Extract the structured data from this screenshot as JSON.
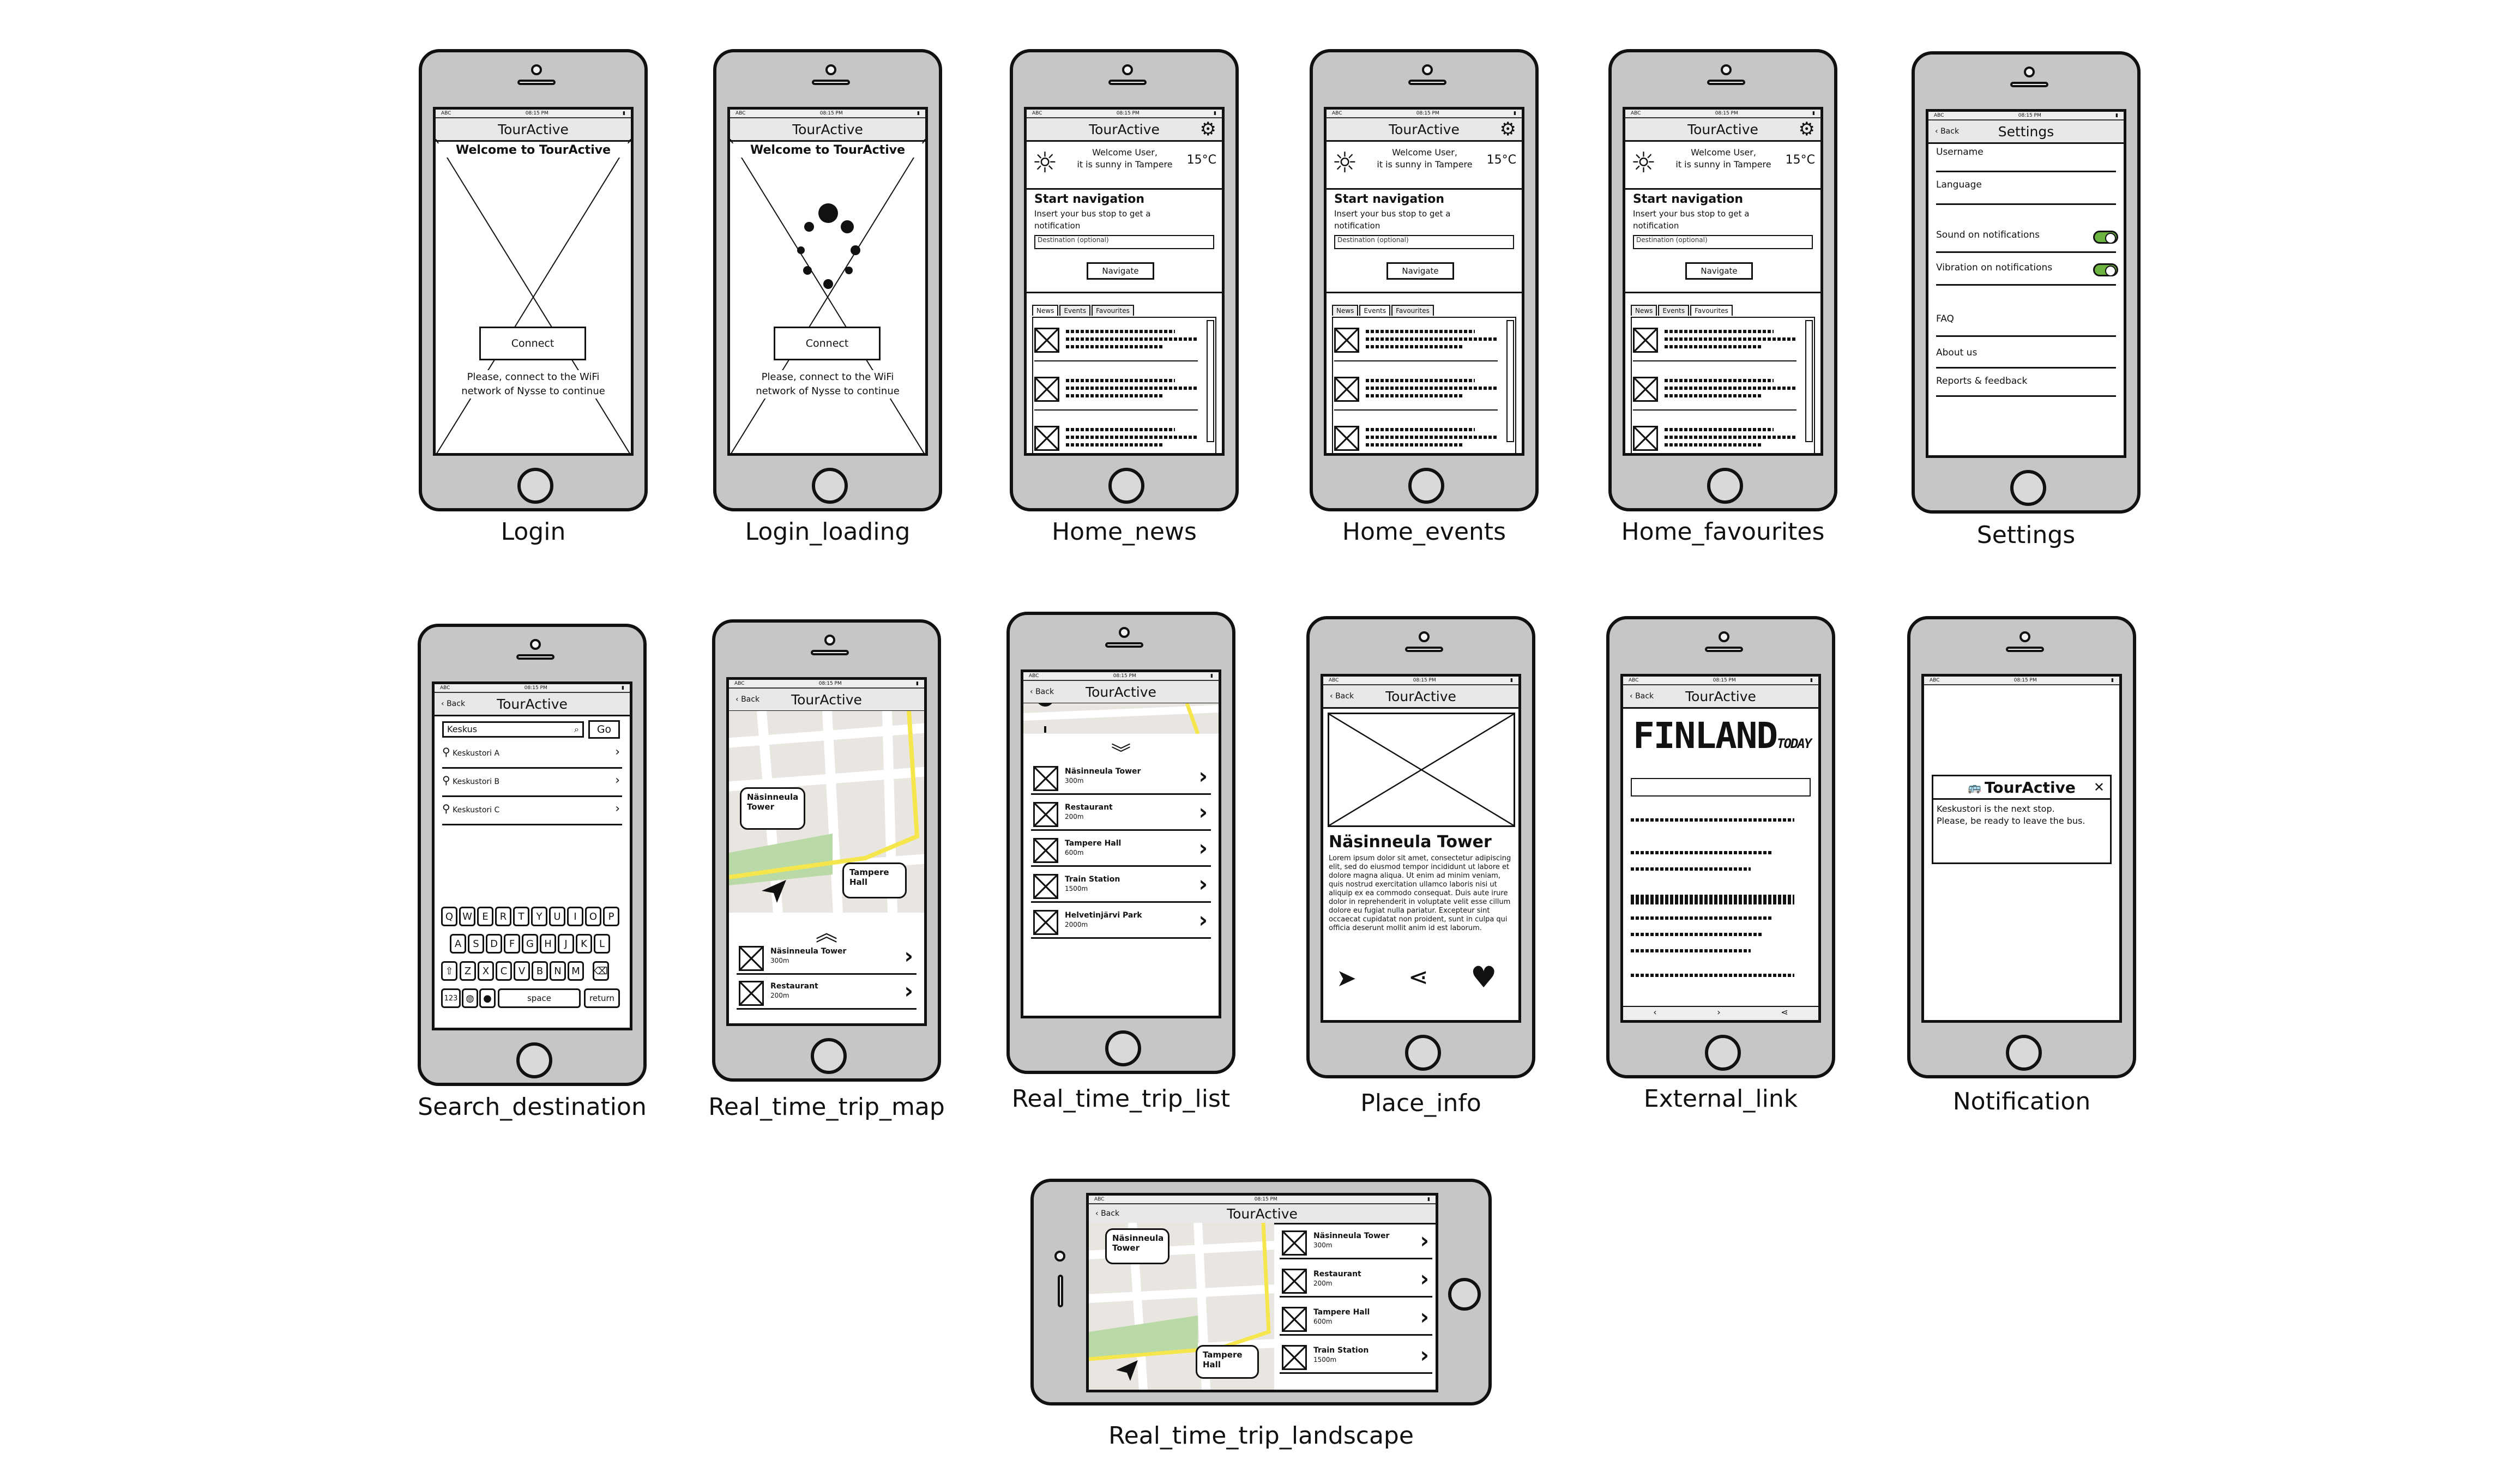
{
  "app": {
    "name": "TourActive",
    "status_left": "ABC",
    "status_time": "08:15 PM"
  },
  "captions": {
    "login": "Login",
    "login_loading": "Login_loading",
    "home_news": "Home_news",
    "home_events": "Home_events",
    "home_favourites": "Home_favourites",
    "settings": "Settings",
    "search": "Search_destination",
    "rt_map": "Real_time_trip_map",
    "rt_list": "Real_time_trip_list",
    "place": "Place_info",
    "external": "External_link",
    "notification": "Notification",
    "landscape": "Real_time_trip_landscape"
  },
  "login": {
    "welcome": "Welcome to TourActive",
    "connect": "Connect",
    "note": "Please, connect to the WiFi network of Nysse to continue"
  },
  "home": {
    "greeting_1": "Welcome User,",
    "greeting_2": "it is sunny in Tampere",
    "temp": "15°C",
    "nav_title": "Start navigation",
    "nav_desc": "Insert your bus stop to get a notification",
    "dest_placeholder": "Destination (optional)",
    "navigate": "Navigate",
    "tabs": [
      "News",
      "Events",
      "Favourites"
    ]
  },
  "settings": {
    "back": "Back",
    "title": "Settings",
    "username": "Username",
    "language": "Language",
    "sound": "Sound on notifications",
    "vibration": "Vibration on notifications",
    "faq": "FAQ",
    "about": "About us",
    "reports": "Reports & feedback"
  },
  "search": {
    "back": "Back",
    "query": "Keskus",
    "go": "Go",
    "results": [
      "Keskustori A",
      "Keskustori B",
      "Keskustori C"
    ],
    "keys_row1": [
      "Q",
      "W",
      "E",
      "R",
      "T",
      "Y",
      "U",
      "I",
      "O",
      "P"
    ],
    "keys_row2": [
      "A",
      "S",
      "D",
      "F",
      "G",
      "H",
      "J",
      "K",
      "L"
    ],
    "keys_row3": [
      "Z",
      "X",
      "C",
      "V",
      "B",
      "N",
      "M"
    ],
    "k123": "123",
    "space": "space",
    "return": "return"
  },
  "trip": {
    "back": "Back",
    "bubble1": "Näsinneula Tower",
    "bubble2": "Tampere Hall",
    "items": [
      {
        "name": "Näsinneula Tower",
        "dist": "300m"
      },
      {
        "name": "Restaurant",
        "dist": "200m"
      },
      {
        "name": "Tampere Hall",
        "dist": "600m"
      },
      {
        "name": "Train Station",
        "dist": "1500m"
      },
      {
        "name": "Helvetinjärvi Park",
        "dist": "2000m"
      }
    ]
  },
  "place": {
    "back": "Back",
    "title": "Näsinneula Tower",
    "body": "Lorem ipsum dolor sit amet, consectetur adipiscing elit, sed do eiusmod tempor incididunt ut labore et dolore magna aliqua. Ut enim ad minim veniam, quis nostrud exercitation ullamco laboris nisi ut aliquip ex ea commodo consequat. Duis aute irure dolor in reprehenderit in voluptate velit esse cillum dolore eu fugiat nulla pariatur. Excepteur sint occaecat cupidatat non proident, sunt in culpa qui officia deserunt mollit anim id est laborum."
  },
  "external": {
    "back": "Back",
    "logo": "FINLAND",
    "logo_sub": "TODAY"
  },
  "notification": {
    "title": "TourActive",
    "line1": "Keskustori is the next stop.",
    "line2": "Please, be ready to leave the bus."
  }
}
